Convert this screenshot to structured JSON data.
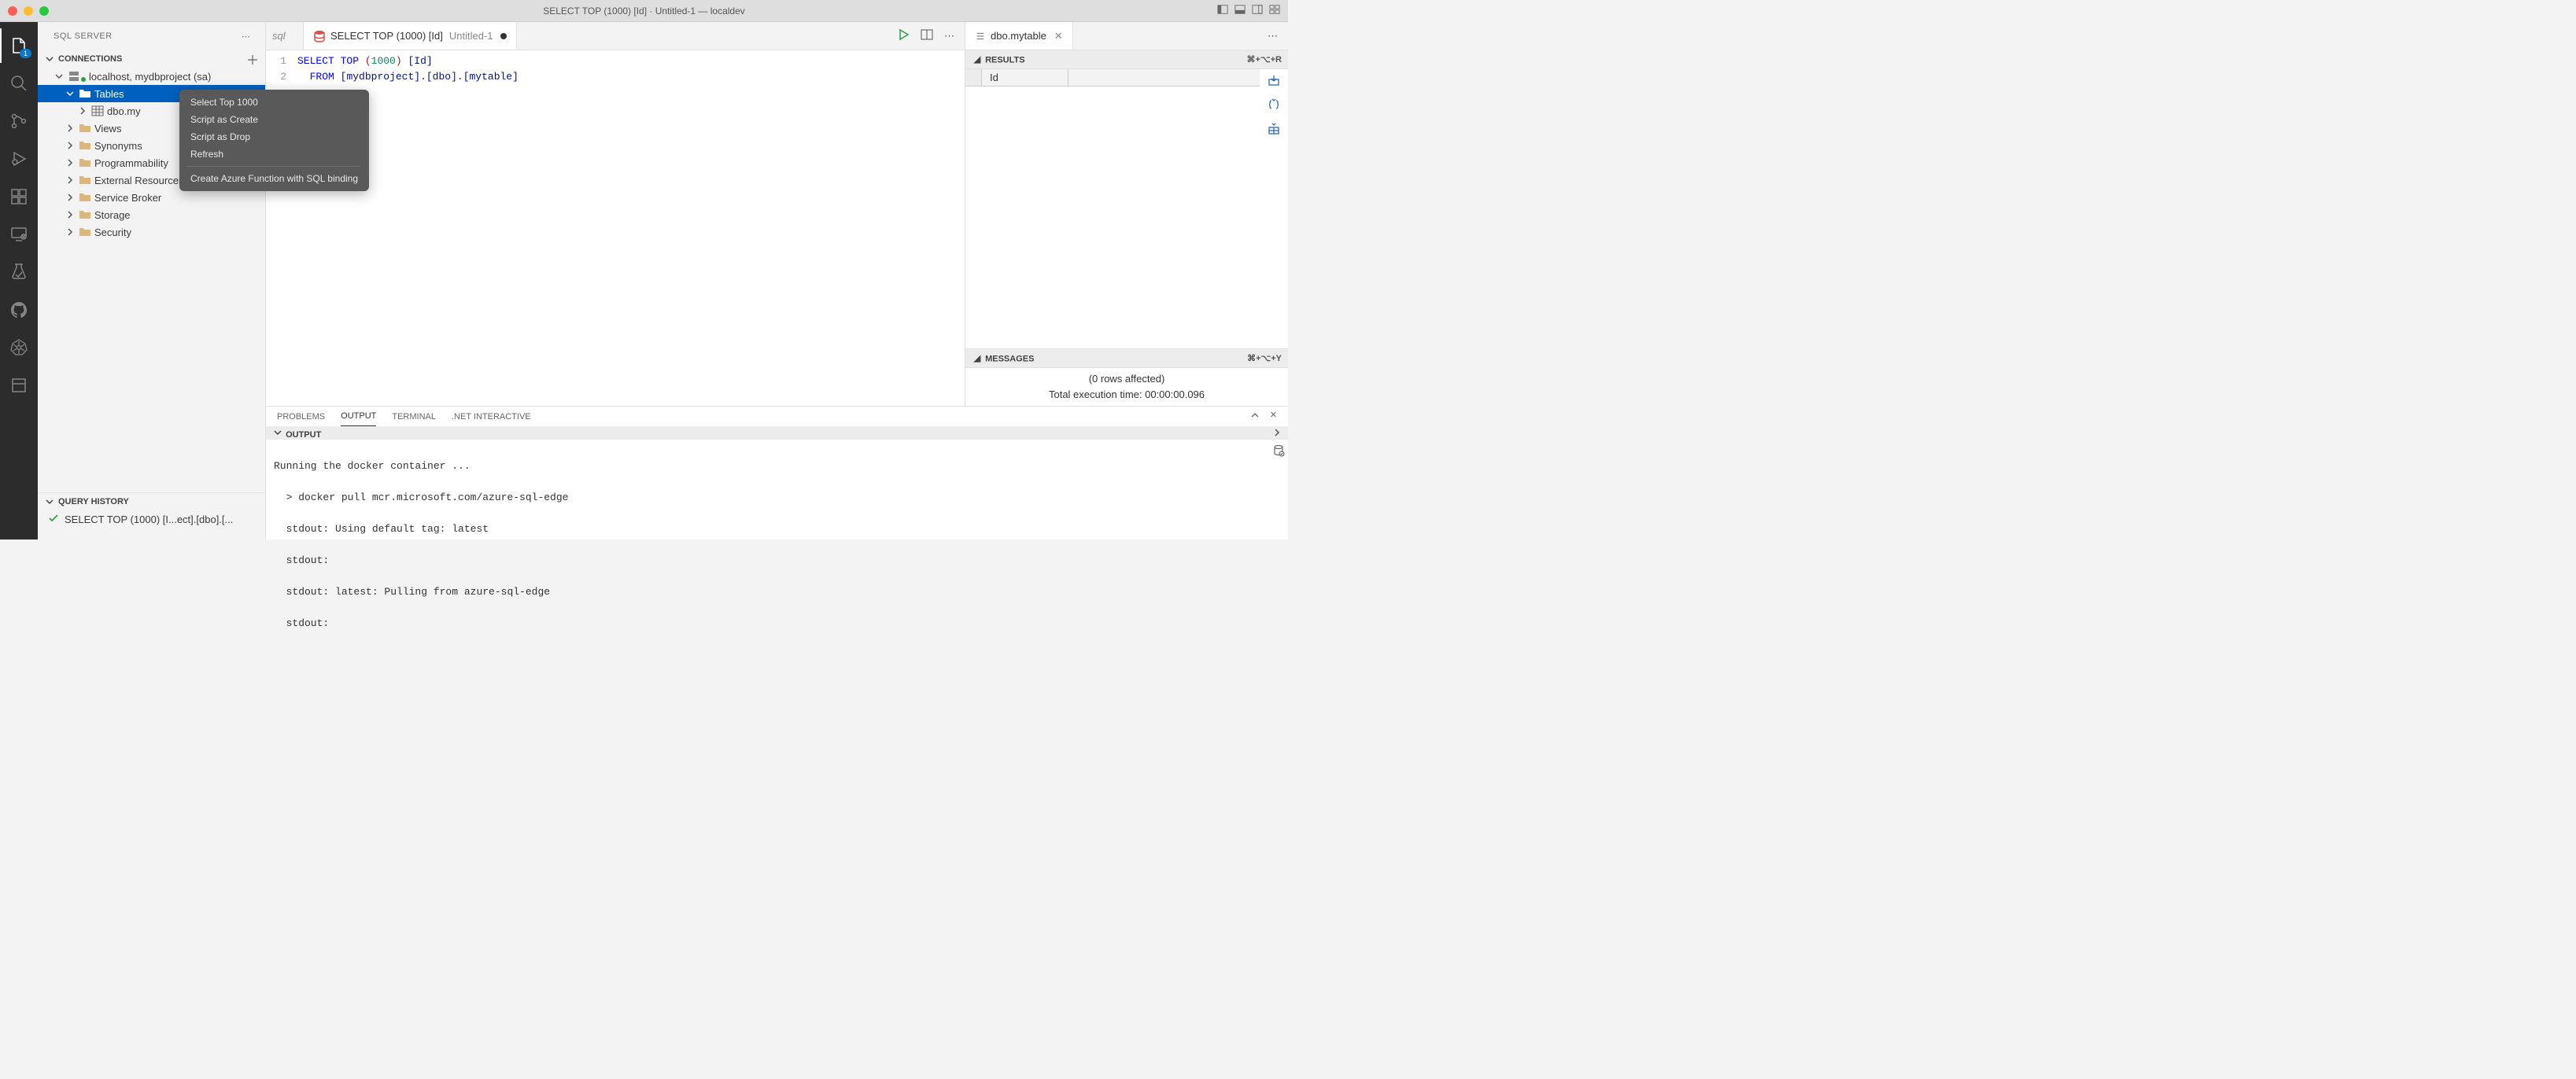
{
  "titlebar": {
    "title": "SELECT TOP (1000) [Id] · Untitled-1 — localdev"
  },
  "activity": {
    "explorer_badge": "1"
  },
  "sidebar": {
    "title": "SQL SERVER",
    "connections_label": "CONNECTIONS",
    "query_history_label": "QUERY HISTORY",
    "connection_name": "localhost, mydbproject (sa)",
    "nodes": {
      "tables": "Tables",
      "mytable": "dbo.my",
      "views": "Views",
      "synonyms": "Synonyms",
      "programmability": "Programmability",
      "external": "External Resources",
      "service_broker": "Service Broker",
      "storage": "Storage",
      "security": "Security"
    },
    "history_item": "SELECT TOP (1000) [I...ect].[dbo].[..."
  },
  "context_menu": {
    "select_top": "Select Top 1000",
    "script_create": "Script as Create",
    "script_drop": "Script as Drop",
    "refresh": "Refresh",
    "azure_fn": "Create Azure Function with SQL binding"
  },
  "tabs": {
    "peek": "sql",
    "left_title": "SELECT TOP (1000) [Id]",
    "left_desc": "Untitled-1",
    "right_title": "dbo.mytable"
  },
  "code": {
    "line1_num": "1",
    "line2_num": "2",
    "kw_select": "SELECT",
    "kw_top": "TOP",
    "paren_open": "(",
    "num_1000": "1000",
    "paren_close": ")",
    "id_col": "[Id]",
    "kw_from": "FROM",
    "db": "[mydbproject]",
    "schema": "[dbo]",
    "table": "[mytable]",
    "dot": "."
  },
  "results": {
    "header": "RESULTS",
    "shortcut": "⌘+⌥+R",
    "col1": "Id",
    "messages_header": "MESSAGES",
    "messages_shortcut": "⌘+⌥+Y",
    "rows_affected": "(0 rows affected)",
    "exec_time": "Total execution time: 00:00:00.096"
  },
  "panel": {
    "problems": "PROBLEMS",
    "output": "OUTPUT",
    "terminal": "TERMINAL",
    "dotnet": ".NET INTERACTIVE",
    "output_header": "OUTPUT",
    "lines": [
      "Running the docker container ...",
      "  > docker pull mcr.microsoft.com/azure-sql-edge",
      "  stdout: Using default tag: latest",
      "  stdout:",
      "  stdout: latest: Pulling from azure-sql-edge",
      "  stdout:"
    ]
  }
}
